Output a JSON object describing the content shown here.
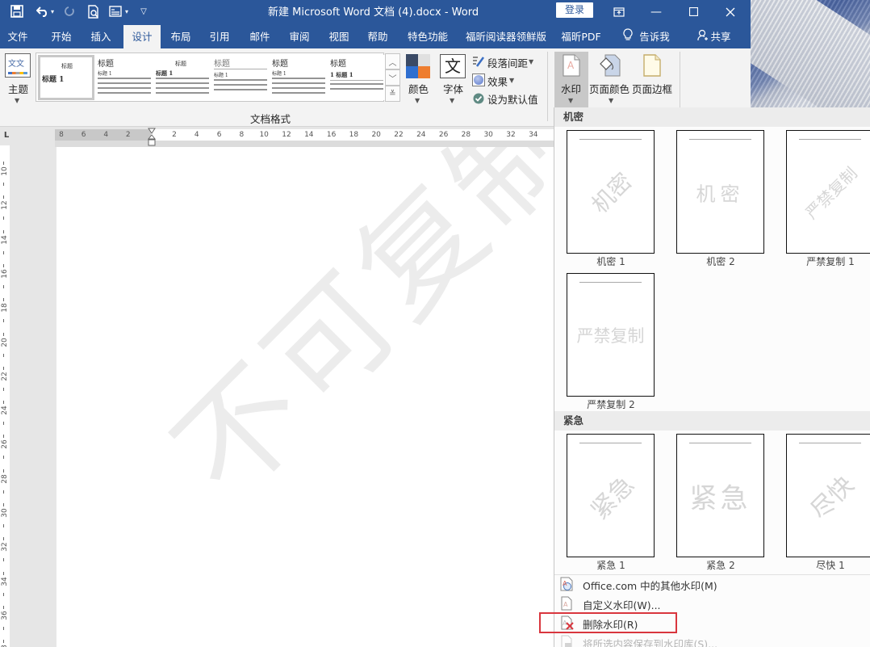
{
  "window": {
    "title": "新建 Microsoft Word 文档 (4).docx  -  Word",
    "login_label": "登录"
  },
  "quick_access": {
    "save": "save-icon",
    "undo": "undo-icon",
    "redo": "redo-icon",
    "print_preview": "print-preview-icon",
    "form": "form-icon",
    "customize": "customize-qat-icon"
  },
  "tabs": [
    {
      "label": "文件"
    },
    {
      "label": "开始"
    },
    {
      "label": "插入"
    },
    {
      "label": "设计",
      "active": true
    },
    {
      "label": "布局"
    },
    {
      "label": "引用"
    },
    {
      "label": "邮件"
    },
    {
      "label": "审阅"
    },
    {
      "label": "视图"
    },
    {
      "label": "帮助"
    },
    {
      "label": "特色功能"
    },
    {
      "label": "福昕阅读器领鲜版"
    },
    {
      "label": "福昕PDF"
    },
    {
      "label": "告诉我"
    },
    {
      "label": "共享"
    }
  ],
  "ribbon": {
    "theme_label": "主题",
    "theme_icon_text": "文文",
    "gallery": [
      {
        "title": "标题",
        "heading": "标题 1"
      },
      {
        "title": "标题",
        "heading": "标题 1"
      },
      {
        "title": "标题",
        "heading": "标题 1"
      },
      {
        "title": "标题",
        "heading": "标题 1"
      },
      {
        "title": "标题",
        "heading": "标题 1"
      },
      {
        "title": "标题",
        "heading": "1  标题 1"
      }
    ],
    "colors_label": "颜色",
    "colors_swatch": [
      "#3a4a66",
      "#e0e0e0",
      "#2f6fd0",
      "#ee7d2f"
    ],
    "fonts_label": "字体",
    "fonts_icon_text": "文",
    "paragraph_spacing_label": "段落间距",
    "effects_label": "效果",
    "set_default_label": "设为默认值",
    "group_label": "文档格式",
    "watermark_label": "水印",
    "page_color_label": "页面颜色",
    "page_borders_label": "页面边框"
  },
  "ruler": {
    "horizontal_left": [
      "8",
      "6",
      "4",
      "2"
    ],
    "horizontal_right": [
      "2",
      "4",
      "6",
      "8",
      "10",
      "12",
      "14",
      "16",
      "18",
      "20",
      "22",
      "24",
      "26",
      "28",
      "30",
      "32",
      "34"
    ],
    "vertical": [
      "10",
      "12",
      "14",
      "16",
      "18",
      "20",
      "22",
      "24",
      "26",
      "28",
      "30",
      "32",
      "34",
      "36",
      "38"
    ]
  },
  "document": {
    "watermark_text": "不可复制"
  },
  "watermark_menu": {
    "sections": [
      {
        "title": "机密",
        "items": [
          {
            "caption": "机密 1",
            "text": "机密",
            "style": "diagonal"
          },
          {
            "caption": "机密 2",
            "text": "机密",
            "style": "horizontal"
          },
          {
            "caption": "严禁复制 1",
            "text": "严禁复制",
            "style": "diagonal"
          },
          {
            "caption": "严禁复制 2",
            "text": "严禁复制",
            "style": "horizontal"
          }
        ]
      },
      {
        "title": "紧急",
        "items": [
          {
            "caption": "紧急 1",
            "text": "紧急",
            "style": "diagonal"
          },
          {
            "caption": "紧急 2",
            "text": "紧急",
            "style": "horizontal"
          },
          {
            "caption": "尽快 1",
            "text": "尽快",
            "style": "diagonal"
          }
        ]
      }
    ],
    "commands": [
      {
        "label": "Office.com 中的其他水印(M)",
        "icon": "office-watermark-icon",
        "enabled": true
      },
      {
        "label": "自定义水印(W)...",
        "icon": "custom-watermark-icon",
        "enabled": true
      },
      {
        "label": "删除水印(R)",
        "icon": "remove-watermark-icon",
        "enabled": true,
        "highlighted": true
      },
      {
        "label": "将所选内容保存到水印库(S)...",
        "icon": "save-to-gallery-icon",
        "enabled": false
      }
    ],
    "highlight_color": "#d9363e"
  }
}
